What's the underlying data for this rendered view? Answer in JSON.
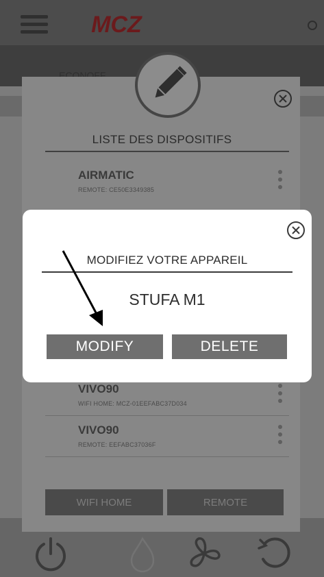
{
  "header": {
    "brand": "MCZ"
  },
  "subbar": {
    "label": "ECONOFF"
  },
  "list_panel": {
    "title": "LISTE DES DISPOSITIFS",
    "devices": [
      {
        "name": "AIRMATIC",
        "sub": "REMOTE: CE50E3349385"
      },
      {
        "name": "VIVO90",
        "sub": "WIFI HOME: MCZ-01EEFABC37D034"
      },
      {
        "name": "VIVO90",
        "sub": "REMOTE: EEFABC37036F"
      }
    ],
    "buttons": {
      "wifi_home": "WIFI HOME",
      "remote": "REMOTE"
    }
  },
  "modal": {
    "title": "MODIFIEZ VOTRE APPAREIL",
    "device_name": "STUFA M1",
    "modify_label": "MODIFY",
    "delete_label": "DELETE"
  },
  "colors": {
    "overlay": "#7c7c7c",
    "panel": "#878787",
    "modal_button": "#6f6f6f",
    "brand_red": "#b01d22"
  },
  "icons": [
    "menu-icon",
    "edit-pencil-icon",
    "close-icon",
    "kebab-icon",
    "power-icon",
    "flame-icon",
    "fan-icon",
    "reset-icon"
  ]
}
